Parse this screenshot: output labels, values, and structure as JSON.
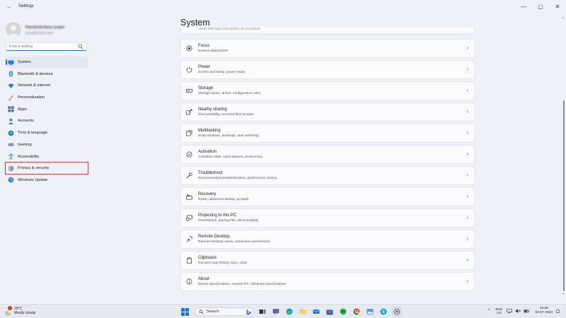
{
  "window": {
    "title": "Settings"
  },
  "user": {
    "name": "Parminderkaur pujari",
    "subtitle": "xxxxx@xxxxxx.com"
  },
  "search": {
    "placeholder": "Find a setting"
  },
  "sidebar": {
    "items": [
      {
        "label": "System",
        "icon": "monitor-icon"
      },
      {
        "label": "Bluetooth & devices",
        "icon": "bluetooth-icon"
      },
      {
        "label": "Network & internet",
        "icon": "wifi-icon"
      },
      {
        "label": "Personalization",
        "icon": "brush-icon"
      },
      {
        "label": "Apps",
        "icon": "apps-icon"
      },
      {
        "label": "Accounts",
        "icon": "person-icon"
      },
      {
        "label": "Time & language",
        "icon": "globe-clock-icon"
      },
      {
        "label": "Gaming",
        "icon": "gamepad-icon"
      },
      {
        "label": "Accessibility",
        "icon": "accessibility-icon"
      },
      {
        "label": "Privacy & security",
        "icon": "shield-icon"
      },
      {
        "label": "Windows Update",
        "icon": "update-icon"
      }
    ]
  },
  "main": {
    "title": "System",
    "cut_text": "Alerts from apps and system, do not disturb",
    "cards": [
      {
        "title": "Focus",
        "desc": "Reduce distractions",
        "icon": "focus-icon"
      },
      {
        "title": "Power",
        "desc": "Screen and sleep, power mode",
        "icon": "power-icon"
      },
      {
        "title": "Storage",
        "desc": "Storage space, drives, configuration rules",
        "icon": "storage-icon"
      },
      {
        "title": "Nearby sharing",
        "desc": "Discoverability, received files location",
        "icon": "share-icon"
      },
      {
        "title": "Multitasking",
        "desc": "Snap windows, desktops, task switching",
        "icon": "multitasking-icon"
      },
      {
        "title": "Activation",
        "desc": "Activation state, subscriptions, product key",
        "icon": "check-circle-icon"
      },
      {
        "title": "Troubleshoot",
        "desc": "Recommended troubleshooters, preferences, history",
        "icon": "wrench-icon"
      },
      {
        "title": "Recovery",
        "desc": "Reset, advanced startup, go back",
        "icon": "recovery-icon"
      },
      {
        "title": "Projecting to this PC",
        "desc": "Permissions, pairing PIN, discoverability",
        "icon": "projector-icon"
      },
      {
        "title": "Remote Desktop",
        "desc": "Remote Desktop users, connection permissions",
        "icon": "remote-desktop-icon"
      },
      {
        "title": "Clipboard",
        "desc": "Cut and copy history, sync, clear",
        "icon": "clipboard-icon"
      },
      {
        "title": "About",
        "desc": "Device specifications, rename PC, Windows specifications",
        "icon": "info-icon"
      }
    ]
  },
  "taskbar": {
    "weather_temp": "29°C",
    "weather_cond": "Mostly cloudy",
    "weather_badge": "1",
    "search_label": "Search",
    "lang_line1": "ENG",
    "lang_line2": "US",
    "time": "12:28",
    "date": "03-07-2023"
  },
  "colors": {
    "accent": "#2f6bd1",
    "highlight_box": "#c8323a"
  }
}
